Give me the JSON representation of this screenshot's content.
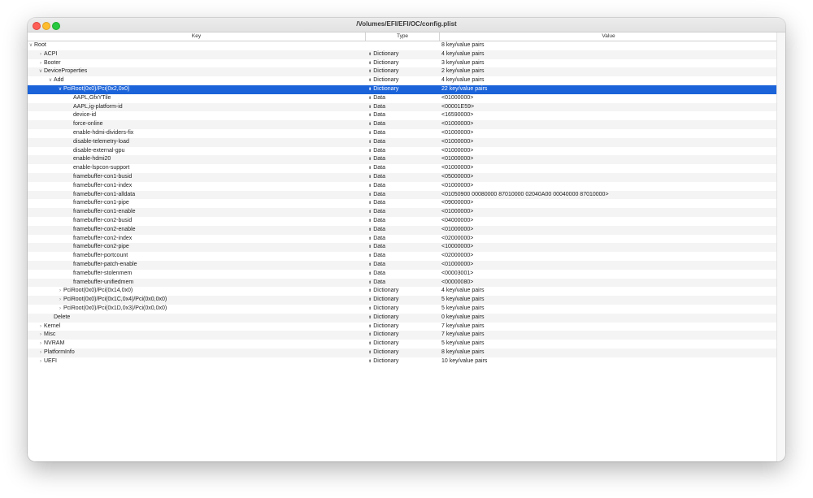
{
  "window": {
    "title": "/Volumes/EFI/EFI/OC/config.plist"
  },
  "columns": {
    "key": "Key",
    "type": "Type",
    "value": "Value"
  },
  "rows": [
    {
      "key": "Root",
      "type": "",
      "value": "8 key/value pairs",
      "depth": 0,
      "disclosure": "expanded"
    },
    {
      "key": "ACPI",
      "type": "Dictionary",
      "value": "4 key/value pairs",
      "depth": 1,
      "disclosure": "collapsed"
    },
    {
      "key": "Booter",
      "type": "Dictionary",
      "value": "3 key/value pairs",
      "depth": 1,
      "disclosure": "collapsed"
    },
    {
      "key": "DeviceProperties",
      "type": "Dictionary",
      "value": "2 key/value pairs",
      "depth": 1,
      "disclosure": "expanded"
    },
    {
      "key": "Add",
      "type": "Dictionary",
      "value": "4 key/value pairs",
      "depth": 2,
      "disclosure": "expanded"
    },
    {
      "key": "PciRoot(0x0)/Pci(0x2,0x0)",
      "type": "Dictionary",
      "value": "22 key/value pairs",
      "depth": 3,
      "disclosure": "expanded",
      "selected": true
    },
    {
      "key": "AAPL,GfxYTile",
      "type": "Data",
      "value": "<01000000>",
      "depth": 4
    },
    {
      "key": "AAPL,ig-platform-id",
      "type": "Data",
      "value": "<00001E59>",
      "depth": 4
    },
    {
      "key": "device-id",
      "type": "Data",
      "value": "<16590000>",
      "depth": 4
    },
    {
      "key": "force-online",
      "type": "Data",
      "value": "<01000000>",
      "depth": 4
    },
    {
      "key": "enable-hdmi-dividers-fix",
      "type": "Data",
      "value": "<01000000>",
      "depth": 4
    },
    {
      "key": "disable-telemetry-load",
      "type": "Data",
      "value": "<01000000>",
      "depth": 4
    },
    {
      "key": "disable-external-gpu",
      "type": "Data",
      "value": "<01000000>",
      "depth": 4
    },
    {
      "key": "enable-hdmi20",
      "type": "Data",
      "value": "<01000000>",
      "depth": 4
    },
    {
      "key": "enable-lspcon-support",
      "type": "Data",
      "value": "<01000000>",
      "depth": 4
    },
    {
      "key": "framebuffer-con1-busid",
      "type": "Data",
      "value": "<05000000>",
      "depth": 4
    },
    {
      "key": "framebuffer-con1-index",
      "type": "Data",
      "value": "<01000000>",
      "depth": 4
    },
    {
      "key": "framebuffer-con1-alldata",
      "type": "Data",
      "value": "<01050900 00080000 87010000 02040A00 00040000 87010000>",
      "depth": 4
    },
    {
      "key": "framebuffer-con1-pipe",
      "type": "Data",
      "value": "<09000000>",
      "depth": 4
    },
    {
      "key": "framebuffer-con1-enable",
      "type": "Data",
      "value": "<01000000>",
      "depth": 4
    },
    {
      "key": "framebuffer-con2-busid",
      "type": "Data",
      "value": "<04000000>",
      "depth": 4
    },
    {
      "key": "framebuffer-con2-enable",
      "type": "Data",
      "value": "<01000000>",
      "depth": 4
    },
    {
      "key": "framebuffer-con2-index",
      "type": "Data",
      "value": "<02000000>",
      "depth": 4
    },
    {
      "key": "framebuffer-con2-pipe",
      "type": "Data",
      "value": "<10000000>",
      "depth": 4
    },
    {
      "key": "framebuffer-portcount",
      "type": "Data",
      "value": "<02000000>",
      "depth": 4
    },
    {
      "key": "framebuffer-patch-enable",
      "type": "Data",
      "value": "<01000000>",
      "depth": 4
    },
    {
      "key": "framebuffer-stolenmem",
      "type": "Data",
      "value": "<00003001>",
      "depth": 4
    },
    {
      "key": "framebuffer-unifiedmem",
      "type": "Data",
      "value": "<00000080>",
      "depth": 4
    },
    {
      "key": "PciRoot(0x0)/Pci(0x14,0x0)",
      "type": "Dictionary",
      "value": "4 key/value pairs",
      "depth": 3,
      "disclosure": "collapsed"
    },
    {
      "key": "PciRoot(0x0)/Pci(0x1C,0x4)/Pci(0x0,0x0)",
      "type": "Dictionary",
      "value": "5 key/value pairs",
      "depth": 3,
      "disclosure": "collapsed"
    },
    {
      "key": "PciRoot(0x0)/Pci(0x1D,0x3)/Pci(0x0,0x0)",
      "type": "Dictionary",
      "value": "5 key/value pairs",
      "depth": 3,
      "disclosure": "collapsed"
    },
    {
      "key": "Delete",
      "type": "Dictionary",
      "value": "0 key/value pairs",
      "depth": 2
    },
    {
      "key": "Kernel",
      "type": "Dictionary",
      "value": "7 key/value pairs",
      "depth": 1,
      "disclosure": "collapsed"
    },
    {
      "key": "Misc",
      "type": "Dictionary",
      "value": "7 key/value pairs",
      "depth": 1,
      "disclosure": "collapsed"
    },
    {
      "key": "NVRAM",
      "type": "Dictionary",
      "value": "5 key/value pairs",
      "depth": 1,
      "disclosure": "collapsed"
    },
    {
      "key": "PlatformInfo",
      "type": "Dictionary",
      "value": "8 key/value pairs",
      "depth": 1,
      "disclosure": "collapsed"
    },
    {
      "key": "UEFI",
      "type": "Dictionary",
      "value": "10 key/value pairs",
      "depth": 1,
      "disclosure": "collapsed"
    }
  ],
  "colors": {
    "selection": "#1b63d9",
    "stripe": "#f4f4f4"
  }
}
